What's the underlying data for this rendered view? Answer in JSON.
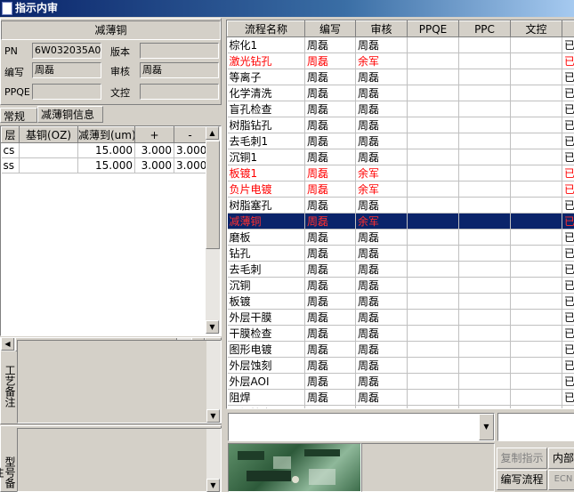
{
  "window": {
    "title": "指示内审"
  },
  "header": {
    "section_title": "减薄铜"
  },
  "form": {
    "pn_label": "PN",
    "pn_value": "6W032035A0",
    "version_label": "版本",
    "version_value": "",
    "writer_label": "编写",
    "writer_value": "周磊",
    "reviewer_label": "审核",
    "reviewer_value": "周磊",
    "ppqe_label": "PPQE",
    "ppqe_value": "",
    "control_label": "文控",
    "control_value": ""
  },
  "tabs": [
    {
      "label": "常规"
    },
    {
      "label": "减薄铜信息"
    }
  ],
  "thin_grid": {
    "headers": [
      "层",
      "基铜(OZ)",
      "减薄到(um)",
      "+",
      "-"
    ],
    "rows": [
      [
        "cs",
        "",
        "15.000",
        "3.000",
        "3.000"
      ],
      [
        "ss",
        "",
        "15.000",
        "3.000",
        "3.000"
      ]
    ]
  },
  "remarks": {
    "process_label": "工艺备注",
    "model_label": "型号备注"
  },
  "flow_grid": {
    "headers": [
      "流程名称",
      "编写",
      "审核",
      "PPQE",
      "PPC",
      "文控",
      ""
    ],
    "status_char": "已",
    "rows": [
      {
        "name": "棕化1",
        "writer": "周磊",
        "reviewer": "周磊",
        "style": "normal"
      },
      {
        "name": "激光钻孔",
        "writer": "周磊",
        "reviewer": "余军",
        "style": "red"
      },
      {
        "name": "等离子",
        "writer": "周磊",
        "reviewer": "周磊",
        "style": "normal"
      },
      {
        "name": "化学清洗",
        "writer": "周磊",
        "reviewer": "周磊",
        "style": "normal"
      },
      {
        "name": "盲孔检查",
        "writer": "周磊",
        "reviewer": "周磊",
        "style": "normal"
      },
      {
        "name": "树脂钻孔",
        "writer": "周磊",
        "reviewer": "周磊",
        "style": "normal"
      },
      {
        "name": "去毛刺1",
        "writer": "周磊",
        "reviewer": "周磊",
        "style": "normal"
      },
      {
        "name": "沉铜1",
        "writer": "周磊",
        "reviewer": "周磊",
        "style": "normal"
      },
      {
        "name": "板镀1",
        "writer": "周磊",
        "reviewer": "余军",
        "style": "red"
      },
      {
        "name": "负片电镀",
        "writer": "周磊",
        "reviewer": "余军",
        "style": "red"
      },
      {
        "name": "树脂塞孔",
        "writer": "周磊",
        "reviewer": "周磊",
        "style": "normal"
      },
      {
        "name": "减薄铜",
        "writer": "周磊",
        "reviewer": "余军",
        "style": "selected"
      },
      {
        "name": "磨板",
        "writer": "周磊",
        "reviewer": "周磊",
        "style": "normal"
      },
      {
        "name": "钻孔",
        "writer": "周磊",
        "reviewer": "周磊",
        "style": "normal"
      },
      {
        "name": "去毛刺",
        "writer": "周磊",
        "reviewer": "周磊",
        "style": "normal"
      },
      {
        "name": "沉铜",
        "writer": "周磊",
        "reviewer": "周磊",
        "style": "normal"
      },
      {
        "name": "板镀",
        "writer": "周磊",
        "reviewer": "周磊",
        "style": "normal"
      },
      {
        "name": "外层干膜",
        "writer": "周磊",
        "reviewer": "周磊",
        "style": "normal"
      },
      {
        "name": "干膜检查",
        "writer": "周磊",
        "reviewer": "周磊",
        "style": "normal"
      },
      {
        "name": "图形电镀",
        "writer": "周磊",
        "reviewer": "周磊",
        "style": "normal"
      },
      {
        "name": "外层蚀刻",
        "writer": "周磊",
        "reviewer": "周磊",
        "style": "normal"
      },
      {
        "name": "外层AOI",
        "writer": "周磊",
        "reviewer": "周磊",
        "style": "normal"
      },
      {
        "name": "阻焊",
        "writer": "周磊",
        "reviewer": "周磊",
        "style": "normal"
      },
      {
        "name": "阻焊检查",
        "writer": "周磊",
        "reviewer": "周磊",
        "style": "normal"
      }
    ]
  },
  "buttons": {
    "copy_instruction": "复制指示",
    "internal": "内部",
    "write_flow": "编写流程",
    "ecn": "ECN"
  },
  "colors": {
    "selected_bg": "#0a246a",
    "red_text": "#ff0000",
    "selected_text": "#ff3030"
  }
}
